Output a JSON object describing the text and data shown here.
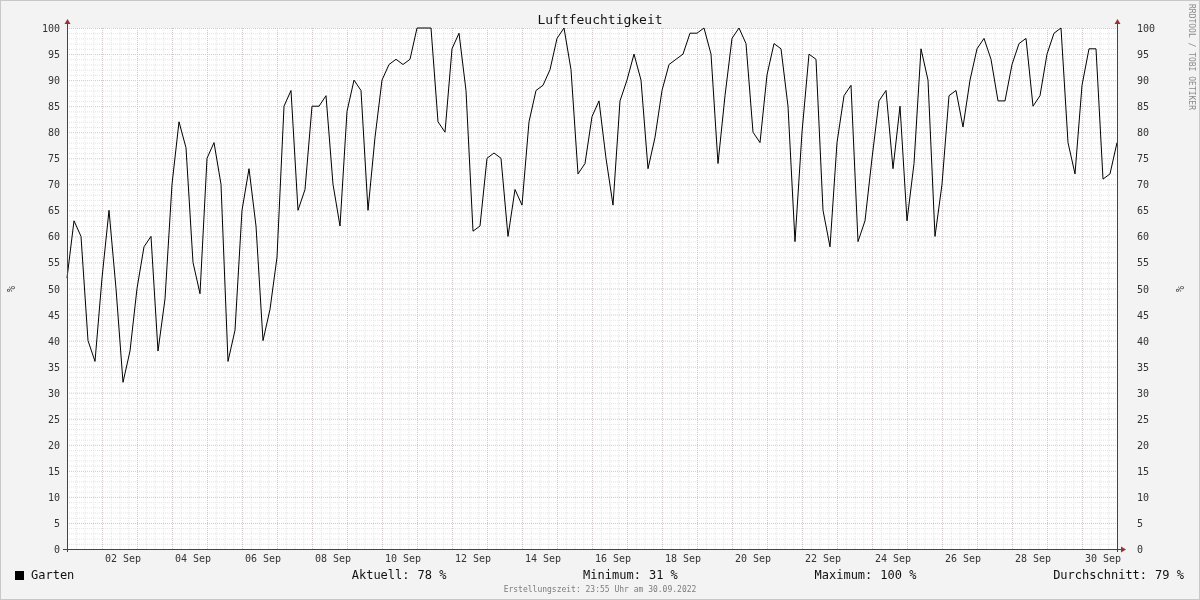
{
  "chart": {
    "chart_data": {
      "type": "line",
      "title": "Luftfeuchtigkeit",
      "ylabel": "%",
      "categories": [
        null,
        null,
        null,
        null,
        null,
        null,
        null,
        null,
        "02 Sep",
        null,
        null,
        null,
        null,
        null,
        null,
        null,
        null,
        null,
        "04 Sep",
        null,
        null,
        null,
        null,
        null,
        null,
        null,
        null,
        null,
        "06 Sep",
        null,
        null,
        null,
        null,
        null,
        null,
        null,
        null,
        null,
        "08 Sep",
        null,
        null,
        null,
        null,
        null,
        null,
        null,
        null,
        null,
        "10 Sep",
        null,
        null,
        null,
        null,
        null,
        null,
        null,
        null,
        null,
        "12 Sep",
        null,
        null,
        null,
        null,
        null,
        null,
        null,
        null,
        null,
        "14 Sep",
        null,
        null,
        null,
        null,
        null,
        null,
        null,
        null,
        null,
        "16 Sep",
        null,
        null,
        null,
        null,
        null,
        null,
        null,
        null,
        null,
        "18 Sep",
        null,
        null,
        null,
        null,
        null,
        null,
        null,
        null,
        null,
        "20 Sep",
        null,
        null,
        null,
        null,
        null,
        null,
        null,
        null,
        null,
        "22 Sep",
        null,
        null,
        null,
        null,
        null,
        null,
        null,
        null,
        null,
        "24 Sep",
        null,
        null,
        null,
        null,
        null,
        null,
        null,
        null,
        null,
        "26 Sep",
        null,
        null,
        null,
        null,
        null,
        null,
        null,
        null,
        null,
        "28 Sep",
        null,
        null,
        null,
        null,
        null,
        null,
        null,
        null,
        null,
        "30 Sep",
        null,
        null
      ],
      "series": [
        {
          "name": "Garten",
          "color": "#000000",
          "values": [
            52,
            63,
            60,
            40,
            36,
            52,
            65,
            50,
            32,
            38,
            50,
            58,
            60,
            38,
            48,
            70,
            82,
            77,
            55,
            49,
            75,
            78,
            70,
            36,
            42,
            65,
            73,
            62,
            40,
            46,
            56,
            85,
            88,
            65,
            69,
            85,
            85,
            87,
            70,
            62,
            84,
            90,
            88,
            65,
            79,
            90,
            93,
            94,
            93,
            94,
            100,
            100,
            100,
            82,
            80,
            96,
            99,
            88,
            61,
            62,
            75,
            76,
            75,
            60,
            69,
            66,
            82,
            88,
            89,
            92,
            98,
            100,
            92,
            72,
            74,
            83,
            86,
            75,
            66,
            86,
            90,
            95,
            90,
            73,
            79,
            88,
            93,
            94,
            95,
            99,
            99,
            100,
            95,
            74,
            87,
            98,
            100,
            97,
            80,
            78,
            91,
            97,
            96,
            85,
            59,
            80,
            95,
            94,
            65,
            58,
            78,
            87,
            89,
            59,
            63,
            75,
            86,
            88,
            73,
            85,
            63,
            74,
            96,
            90,
            60,
            70,
            87,
            88,
            81,
            90,
            96,
            98,
            94,
            86,
            86,
            93,
            97,
            98,
            85,
            87,
            95,
            99,
            100,
            78,
            72,
            89,
            96,
            96,
            71,
            72,
            78
          ]
        }
      ],
      "ylim": [
        0,
        100
      ],
      "grid": true,
      "yticks": [
        0,
        5,
        10,
        15,
        20,
        25,
        30,
        35,
        40,
        45,
        50,
        55,
        60,
        65,
        70,
        75,
        80,
        85,
        90,
        95,
        100
      ]
    },
    "right_axis": {
      "label": "%",
      "ticks": [
        "100",
        "95",
        "90",
        "85",
        "80",
        "75",
        "70",
        "65",
        "60",
        "55",
        "50",
        "45",
        "40",
        "35",
        "30",
        "25",
        "20",
        "15",
        "10",
        "5",
        "0"
      ]
    },
    "credit": "RRDTOOL / TOBI OETIKER"
  },
  "legend": {
    "stats": [
      {
        "label": "Aktuell:",
        "value": "78 %"
      },
      {
        "label": "Minimum:",
        "value": "31 %"
      },
      {
        "label": "Maximum:",
        "value": "100 %"
      },
      {
        "label": "Durchschnitt:",
        "value": "79 %"
      }
    ]
  },
  "footer": "Erstellungszeit: 23:55 Uhr am 30.09.2022"
}
